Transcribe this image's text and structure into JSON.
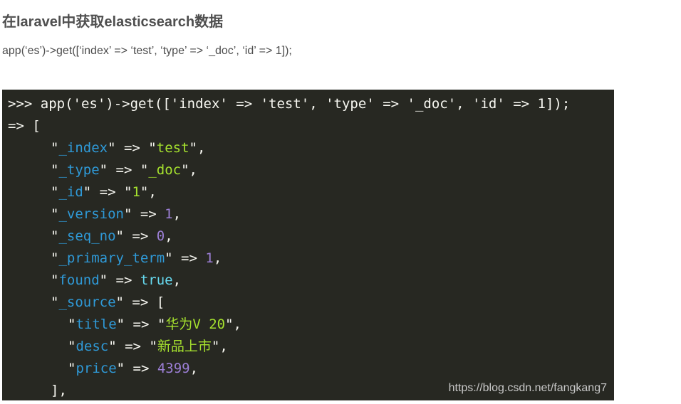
{
  "article": {
    "title": "在laravel中获取elasticsearch数据",
    "inline_code": "app(‘es’)->get([‘index’ => ‘test’, ‘type’ => ‘_doc’, ‘id’ => 1]);"
  },
  "code_block": {
    "command": ">>> app('es')->get(['index' => 'test', 'type' => '_doc', 'id' => 1]);",
    "result_open": "=> [",
    "fields": [
      {
        "key": "_index",
        "value": "test",
        "type": "string"
      },
      {
        "key": "_type",
        "value": "_doc",
        "type": "string"
      },
      {
        "key": "_id",
        "value": "1",
        "type": "string"
      },
      {
        "key": "_version",
        "value": "1",
        "type": "number"
      },
      {
        "key": "_seq_no",
        "value": "0",
        "type": "number"
      },
      {
        "key": "_primary_term",
        "value": "1",
        "type": "number"
      },
      {
        "key": "found",
        "value": "true",
        "type": "bool"
      }
    ],
    "source_key": "_source",
    "source_fields": [
      {
        "key": "title",
        "value": "华为V 20",
        "type": "string"
      },
      {
        "key": "desc",
        "value": "新品上市",
        "type": "string"
      },
      {
        "key": "price",
        "value": "4399",
        "type": "number"
      }
    ],
    "source_close": "],",
    "watermark": "https://blog.csdn.net/fangkang7"
  },
  "colors": {
    "code_background": "#272822",
    "key": "#2f9ad8",
    "string": "#a6e22e",
    "number": "#9c7fd6",
    "boolean": "#66d9ef"
  }
}
